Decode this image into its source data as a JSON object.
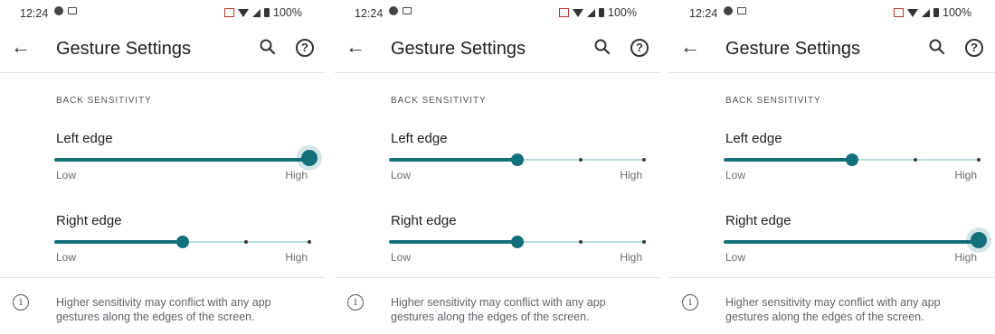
{
  "statusbar": {
    "time": "12:24",
    "battery": "100%"
  },
  "toolbar": {
    "title": "Gesture Settings"
  },
  "section_header": "BACK SENSITIVITY",
  "labels": {
    "left_edge": "Left edge",
    "right_edge": "Right edge",
    "low": "Low",
    "high": "High"
  },
  "footer": "Higher sensitivity may conflict with any app gestures along the edges of the screen.",
  "accent_color": "#13707a",
  "slider_steps": 4,
  "screens": [
    {
      "left_edge_level": 4,
      "right_edge_level": 2
    },
    {
      "left_edge_level": 2,
      "right_edge_level": 2
    },
    {
      "left_edge_level": 2,
      "right_edge_level": 4
    }
  ],
  "icons": [
    "back-arrow-icon",
    "search-icon",
    "help-icon",
    "info-icon",
    "wifi-icon",
    "signal-icon",
    "battery-icon"
  ]
}
